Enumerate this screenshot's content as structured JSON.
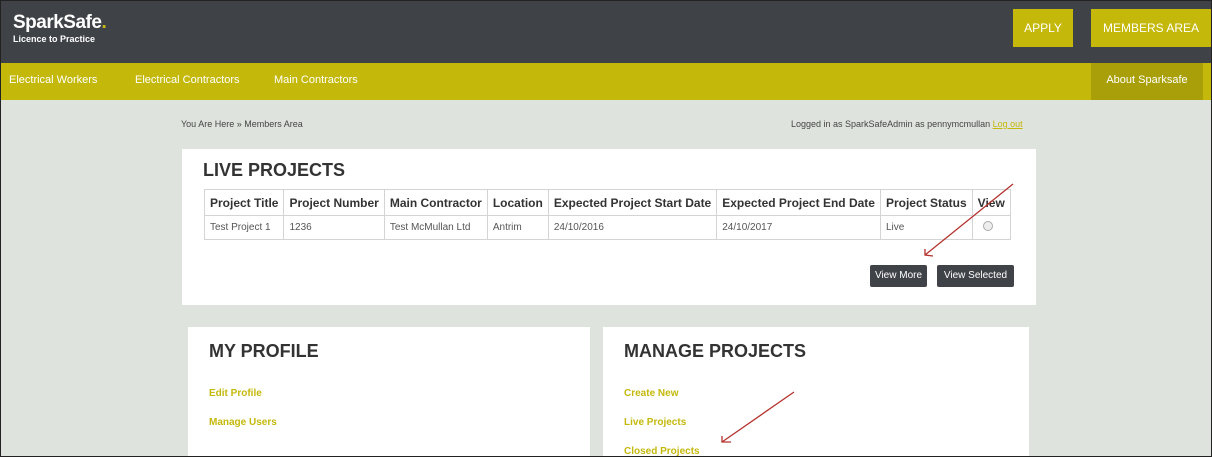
{
  "header": {
    "logo_main": "SparkSafe",
    "logo_dot": ".",
    "logo_sub": "Licence to Practice",
    "apply_label": "APPLY",
    "members_label": "MEMBERS AREA"
  },
  "nav": {
    "items": [
      "Electrical Workers",
      "Electrical Contractors",
      "Main Contractors"
    ],
    "about_label": "About Sparksafe"
  },
  "breadcrumb": "You Are Here » Members Area",
  "login": {
    "text": "Logged in as SparkSafeAdmin as pennymcmullan",
    "logout_label": "Log out"
  },
  "live_projects": {
    "title": "LIVE PROJECTS",
    "columns": [
      "Project Title",
      "Project Number",
      "Main Contractor",
      "Location",
      "Expected Project Start Date",
      "Expected Project End Date",
      "Project Status",
      "View"
    ],
    "rows": [
      [
        "Test Project 1",
        "1236",
        "Test McMullan Ltd",
        "Antrim",
        "24/10/2016",
        "24/10/2017",
        "Live"
      ]
    ],
    "view_more_label": "View More",
    "view_selected_label": "View Selected"
  },
  "profile": {
    "title": "MY PROFILE",
    "links": [
      "Edit Profile",
      "Manage Users"
    ]
  },
  "manage": {
    "title": "MANAGE PROJECTS",
    "links": [
      "Create New",
      "Live Projects",
      "Closed Projects"
    ]
  },
  "colors": {
    "accent": "#c4b80b",
    "dark": "#3f4247",
    "background": "#dfe3de",
    "annotation_arrow": "#b5332e"
  }
}
